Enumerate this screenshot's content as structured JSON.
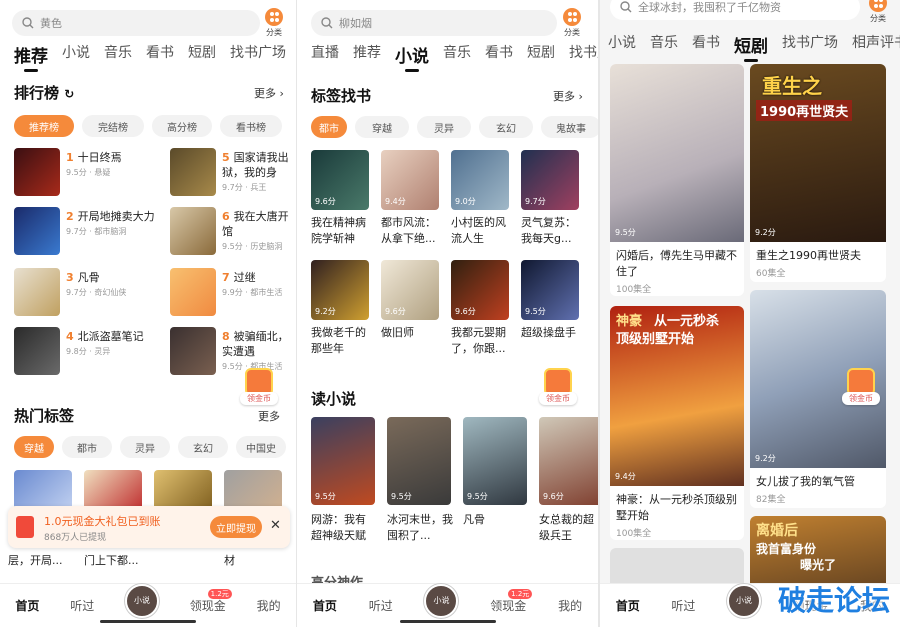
{
  "panel1": {
    "search_placeholder": "黄色",
    "category_label": "分类",
    "tabs": [
      "推荐",
      "小说",
      "音乐",
      "看书",
      "短剧",
      "找书广场",
      "相"
    ],
    "rank_title": "排行榜",
    "more": "更多",
    "rank_pills": [
      "推荐榜",
      "完结榜",
      "高分榜",
      "看书榜"
    ],
    "rank_items": [
      {
        "num": "1",
        "title": "十日终焉",
        "sub": "9.5分 · 悬疑"
      },
      {
        "num": "5",
        "title": "国家请我出狱，我的身",
        "sub": "9.7分 · 兵王"
      },
      {
        "num": "2",
        "title": "开局地摊卖大力",
        "sub": "9.7分 · 都市脑洞"
      },
      {
        "num": "6",
        "title": "我在大唐开馆",
        "sub": "9.5分 · 历史脑洞"
      },
      {
        "num": "3",
        "title": "凡骨",
        "sub": "9.7分 · 奇幻仙侠"
      },
      {
        "num": "7",
        "title": "过继",
        "sub": "9.9分 · 都市生活"
      },
      {
        "num": "4",
        "title": "北派盗墓笔记",
        "sub": "9.8分 · 灵异"
      },
      {
        "num": "8",
        "title": "被骗缅北，实遭遇",
        "sub": "9.5分 · 都市生活"
      }
    ],
    "hot_title": "热门标签",
    "hot_pills": [
      "穿越",
      "都市",
      "灵异",
      "玄幻",
      "中国史"
    ],
    "bottom_titles": [
      "层，开局...",
      "门上下都...",
      "",
      "材"
    ],
    "toast_title": "1.0元现金大礼包已到账",
    "toast_sub": "868万人已提现",
    "toast_button": "立即提现",
    "coin_label": "领金币"
  },
  "panel2": {
    "search_placeholder": "柳如烟",
    "category_label": "分类",
    "tabs": [
      "直播",
      "推荐",
      "小说",
      "音乐",
      "看书",
      "短剧",
      "找书广"
    ],
    "tag_title": "标签找书",
    "more": "更多",
    "tag_pills": [
      "都市",
      "穿越",
      "灵异",
      "玄幻",
      "鬼故事"
    ],
    "books_row1": [
      {
        "title": "我在精神病院学斩神",
        "rate": "9.6分"
      },
      {
        "title": "都市风流：从拿下绝...",
        "rate": "9.4分"
      },
      {
        "title": "小村医的风流人生",
        "rate": "9.0分"
      },
      {
        "title": "灵气复苏：我每天g...",
        "rate": "9.7分"
      }
    ],
    "books_row2": [
      {
        "title": "我做老千的那些年",
        "rate": "9.2分"
      },
      {
        "title": "做旧师",
        "rate": "9.6分"
      },
      {
        "title": "我都元婴期了，你跟...",
        "rate": "9.6分"
      },
      {
        "title": "超级操盘手",
        "rate": "9.5分"
      }
    ],
    "read_title": "读小说",
    "books_row3": [
      {
        "title": "网游：我有超神级天赋",
        "rate": "9.5分"
      },
      {
        "title": "冰河末世，我囤积了...",
        "rate": "9.5分"
      },
      {
        "title": "凡骨",
        "rate": "9.5分"
      },
      {
        "title": "女总裁的超级兵王",
        "rate": "9.6分"
      }
    ],
    "peek_title": "高分神作",
    "coin_label": "领金币"
  },
  "panel3": {
    "search_placeholder": "全球冰封，我囤积了千亿物资",
    "category_label": "分类",
    "tabs": [
      "小说",
      "音乐",
      "看书",
      "短剧",
      "找书广场",
      "相声评书"
    ],
    "dramas": [
      {
        "title": "闪婚后，傅先生马甲藏不住了",
        "eps": "100集全",
        "rate": "9.5分"
      },
      {
        "title": "重生之1990再世贤夫",
        "eps": "60集全",
        "rate": "9.2分"
      },
      {
        "title": "神豪：从一元秒杀顶级别墅开始",
        "eps": "100集全",
        "rate": "9.4分"
      },
      {
        "title": "女儿拔了我的氧气管",
        "eps": "82集全",
        "rate": "9.2分"
      }
    ],
    "poster_texts": [
      "重生之",
      "1990再世贤夫",
      "神豪",
      "从一元秒杀",
      "顶级别墅开始",
      "离婚后",
      "我首富身份",
      "曝光了"
    ],
    "coin_label": "领金币"
  },
  "bottom_nav": [
    "首页",
    "听过",
    "领现金",
    "我的"
  ],
  "nav_badge": "1.2元",
  "avatar_label": "小说",
  "watermark": "破走论坛"
}
